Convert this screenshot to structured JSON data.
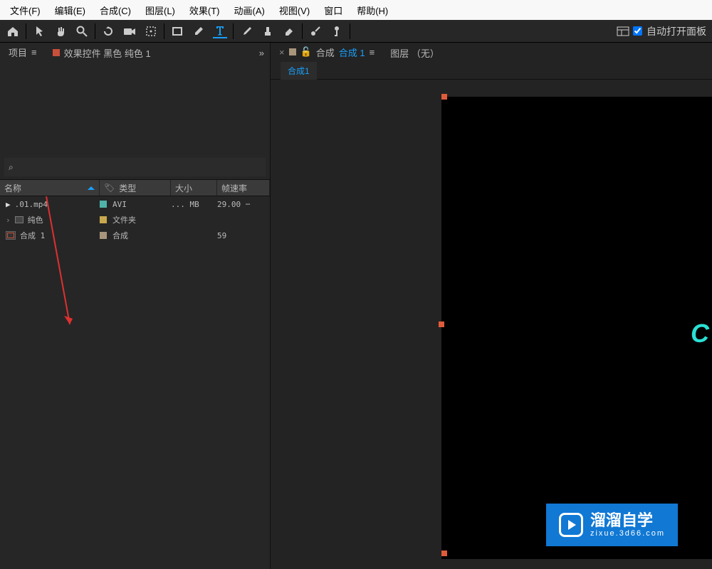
{
  "menu": [
    "文件(F)",
    "编辑(E)",
    "合成(C)",
    "图层(L)",
    "效果(T)",
    "动画(A)",
    "视图(V)",
    "窗口",
    "帮助(H)"
  ],
  "toolbar": {
    "auto_open_panels": "自动打开面板"
  },
  "project_panel": {
    "project_tab": "项目",
    "effect_controls_tab": "效果控件 黑色 纯色 1",
    "search_placeholder": "",
    "search_icon": "⌕",
    "columns": {
      "name": "名称",
      "type": "类型",
      "size": "大小",
      "fps": "帧速率"
    },
    "rows": [
      {
        "name": ".01.mp4",
        "type": "AVI",
        "size": "... MB",
        "fps": "29.00"
      },
      {
        "name": "纯色",
        "type": "文件夹",
        "size": "",
        "fps": ""
      },
      {
        "name": "合成 1",
        "type": "合成",
        "size": "",
        "fps": "59"
      }
    ]
  },
  "comp_panel": {
    "comp_label_prefix": "合成",
    "comp_name": "合成 1",
    "layer_tab": "图层 （无）",
    "sub_tab": "合成1"
  },
  "logo": {
    "line1": "溜溜自学",
    "line2": "zixue.3d66.com"
  }
}
